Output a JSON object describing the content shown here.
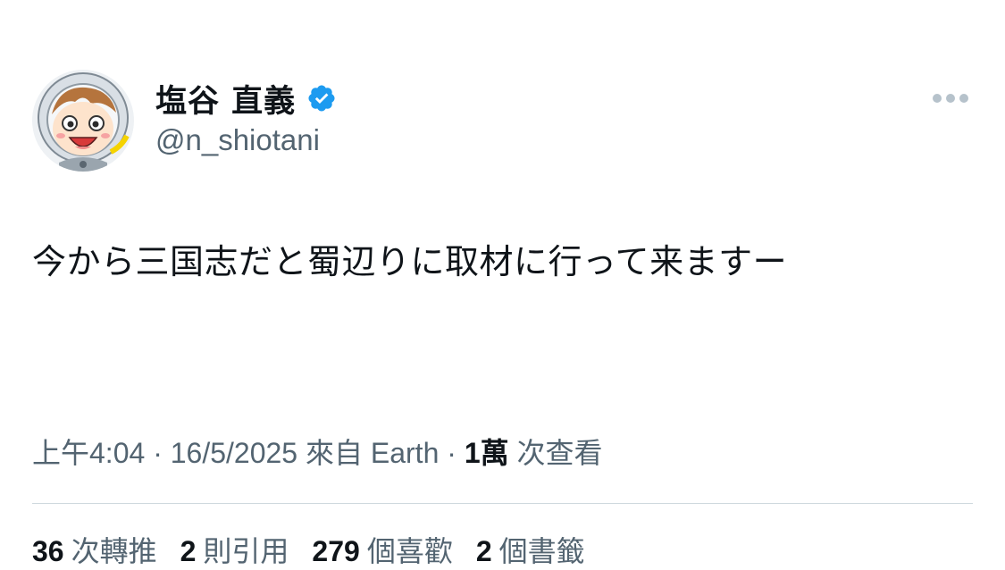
{
  "author": {
    "display_name": "塩谷 直義",
    "handle": "@n_shiotani",
    "verified": true
  },
  "tweet": {
    "text": "今から三国志だと蜀辺りに取材に行って来ますー"
  },
  "meta": {
    "time": "上午4:04",
    "sep1": " · ",
    "date": "16/5/2025",
    "source": " 來自 Earth",
    "sep2": " · ",
    "views_count": "1萬",
    "views_label": " 次查看"
  },
  "stats": [
    {
      "num": "36",
      "label": "次轉推"
    },
    {
      "num": "2",
      "label": "則引用"
    },
    {
      "num": "279",
      "label": "個喜歡"
    },
    {
      "num": "2",
      "label": "個書籤"
    }
  ],
  "colors": {
    "text_primary": "#0f1419",
    "text_secondary": "#536471",
    "verified_blue": "#1d9bf0",
    "divider": "#cfd9de",
    "more_dots": "#b6c2cb"
  },
  "icons": {
    "verified": "verified-badge-icon",
    "more": "more-options-icon",
    "avatar": "cartoon-astronaut-avatar"
  }
}
